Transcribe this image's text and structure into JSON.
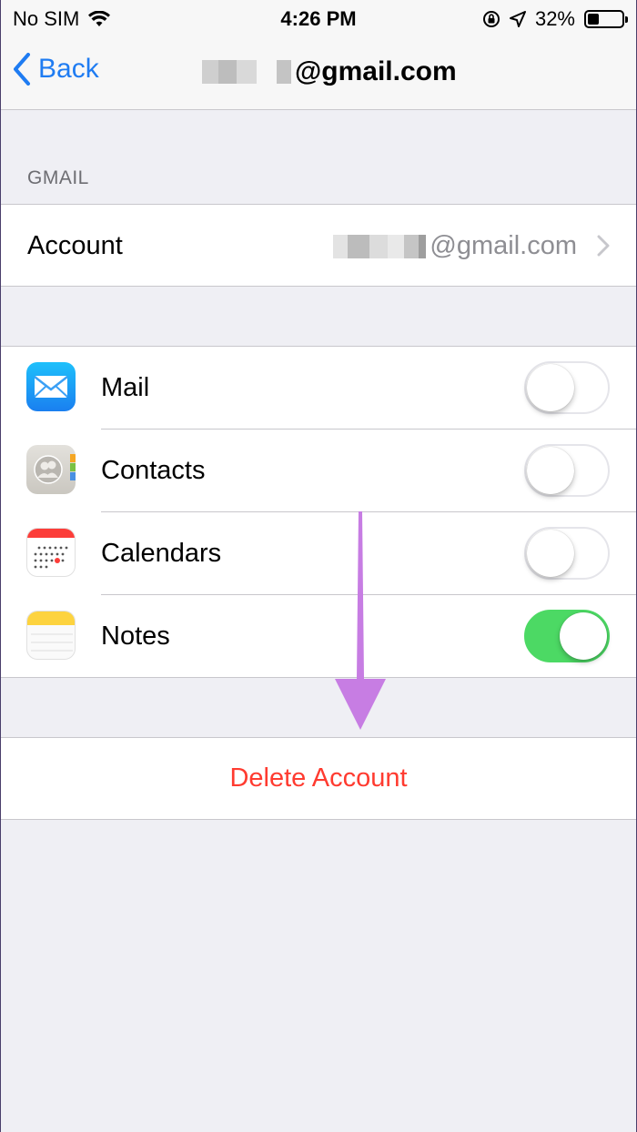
{
  "status_bar": {
    "carrier": "No SIM",
    "time": "4:26 PM",
    "battery_text": "32%",
    "battery_level": 0.32
  },
  "nav": {
    "back_label": "Back",
    "title_suffix": "@gmail.com"
  },
  "section": {
    "header": "GMAIL"
  },
  "account": {
    "label": "Account",
    "value_suffix": "@gmail.com"
  },
  "apps": [
    {
      "label": "Mail",
      "icon": "mail-icon",
      "enabled": false
    },
    {
      "label": "Contacts",
      "icon": "contacts-icon",
      "enabled": false
    },
    {
      "label": "Calendars",
      "icon": "calendar-icon",
      "enabled": false
    },
    {
      "label": "Notes",
      "icon": "notes-icon",
      "enabled": true
    }
  ],
  "delete_label": "Delete Account",
  "colors": {
    "accent": "#1f7cf2",
    "destructive": "#ff3b30",
    "toggle_on": "#4cd964",
    "annotation_arrow": "#c77de3"
  }
}
